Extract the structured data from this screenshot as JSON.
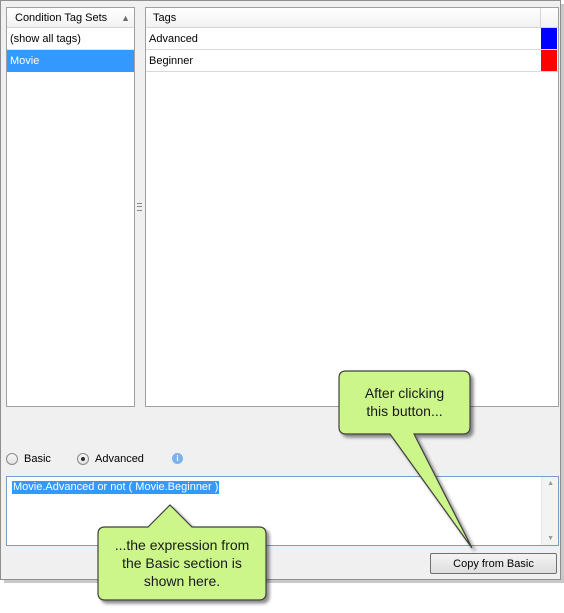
{
  "condition_tag_sets": {
    "header": "Condition Tag Sets",
    "items": [
      {
        "label": "(show all tags)",
        "selected": false
      },
      {
        "label": "Movie",
        "selected": true
      }
    ]
  },
  "tags": {
    "header": "Tags",
    "rows": [
      {
        "label": "Advanced",
        "color": "#0000ff"
      },
      {
        "label": "Beginner",
        "color": "#ff0000"
      }
    ]
  },
  "mode": {
    "basic_label": "Basic",
    "advanced_label": "Advanced",
    "selected": "Advanced"
  },
  "expression": {
    "value": "Movie.Advanced or not ( Movie.Beginner )"
  },
  "buttons": {
    "copy_from_basic": "Copy from Basic"
  },
  "callouts": {
    "button_note_line1": "After clicking",
    "button_note_line2": "this button...",
    "expression_note_line1": "...the expression from",
    "expression_note_line2": "the Basic section is",
    "expression_note_line3": "shown here."
  },
  "colors": {
    "selection": "#3399ff",
    "callout_fill": "#ccf58a"
  }
}
